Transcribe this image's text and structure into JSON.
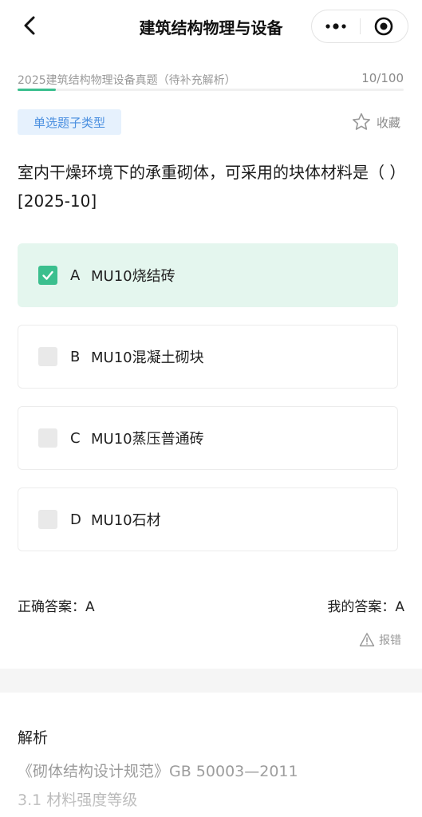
{
  "navbar": {
    "title": "建筑结构物理与设备"
  },
  "progress": {
    "title": "2025建筑结构物理设备真题（待补充解析）",
    "count": "10/100",
    "fraction": 0.1,
    "accent": "#3bbf8e"
  },
  "question": {
    "type_tag": "单选题子类型",
    "favorite_label": "收藏",
    "stem": "室内干燥环境下的承重砌体，可采用的块体材料是（ ）[2025-10]",
    "options": [
      {
        "letter": "A",
        "text": "MU10烧结砖",
        "selected": true
      },
      {
        "letter": "B",
        "text": "MU10混凝土砌块",
        "selected": false
      },
      {
        "letter": "C",
        "text": "MU10蒸压普通砖",
        "selected": false
      },
      {
        "letter": "D",
        "text": "MU10石材",
        "selected": false
      }
    ]
  },
  "answers": {
    "correct": "正确答案：A",
    "mine": "我的答案：A",
    "report_label": "报错"
  },
  "analysis": {
    "heading": "解析",
    "line1": "《砌体结构设计规范》GB 50003—2011",
    "line2": "3.1 材料强度等级"
  },
  "colors": {
    "selected_bg": "#e4f6ee",
    "check": "#3bbf8e",
    "tag_bg": "#e6f1fd",
    "tag_text": "#4a8fe0"
  },
  "icons": [
    "back-arrow-icon",
    "more-dots-icon",
    "target-circle-icon",
    "star-icon",
    "check-icon",
    "warning-triangle-icon"
  ]
}
